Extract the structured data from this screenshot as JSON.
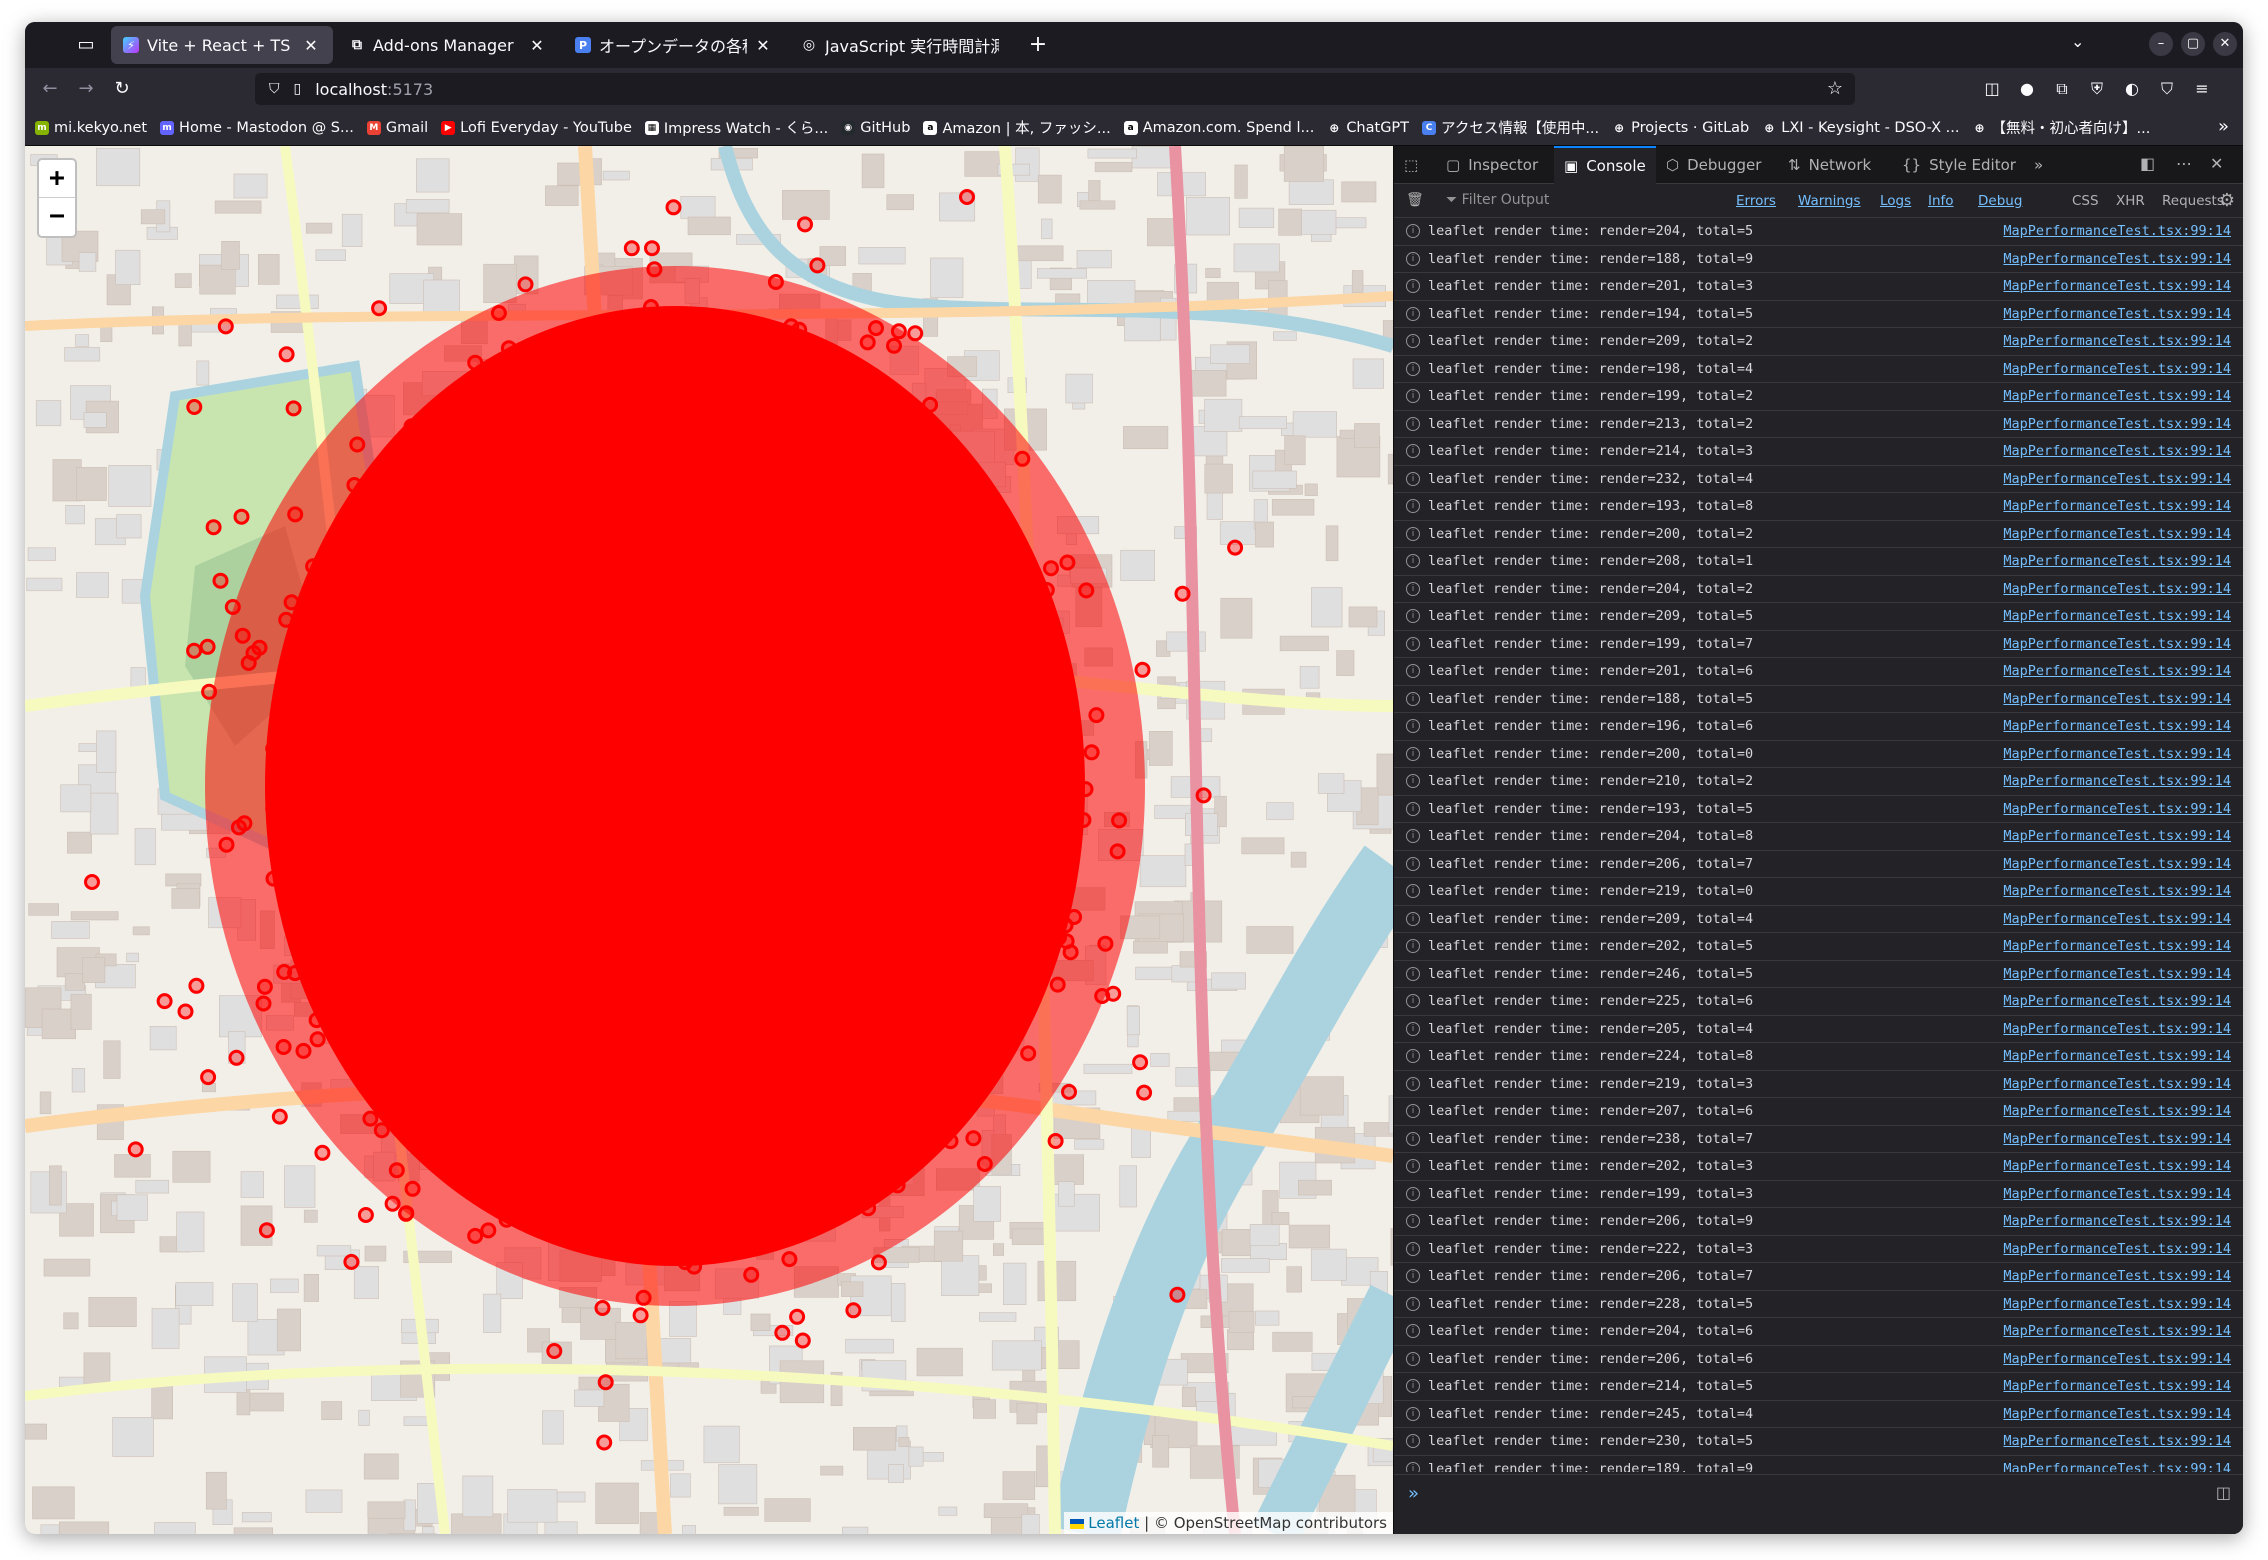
{
  "browser": {
    "tabs": [
      {
        "label": "Vite + React + TS",
        "active": true
      },
      {
        "label": "Add-ons Manager",
        "active": false
      },
      {
        "label": "オープンデータの各種マ",
        "active": false
      },
      {
        "label": "JavaScript 実行時間計測",
        "active": false
      }
    ],
    "new_tab": "+",
    "url_host": "localhost",
    "url_port": ":5173"
  },
  "bookmarks": [
    "mi.kekyo.net",
    "Home - Mastodon @ S...",
    "Gmail",
    "Lofi Everyday - YouTube",
    "Impress Watch - くら...",
    "GitHub",
    "Amazon | 本, ファッシ...",
    "Amazon.com. Spend l...",
    "ChatGPT",
    "アクセス情報【使用中...",
    "Projects · GitLab",
    "LXI - Keysight - DSO-X ...",
    "【無料・初心者向け】..."
  ],
  "map": {
    "zoom_in": "+",
    "zoom_out": "−",
    "attribution_leaflet": "Leaflet",
    "attribution_rest": " | © OpenStreetMap contributors",
    "marker_color": "#ff0000"
  },
  "devtools": {
    "tabs": [
      "Inspector",
      "Console",
      "Debugger",
      "Network",
      "Style Editor"
    ],
    "active_tab": "Console",
    "filter_placeholder": "Filter Output",
    "levels": [
      "Errors",
      "Warnings",
      "Logs",
      "Info",
      "Debug"
    ],
    "types": [
      "CSS",
      "XHR",
      "Requests"
    ],
    "log_prefix": "leaflet render time: ",
    "log_source": "MapPerformanceTest.tsx:99:14",
    "logs": [
      [
        204,
        5
      ],
      [
        188,
        9
      ],
      [
        201,
        3
      ],
      [
        194,
        5
      ],
      [
        209,
        2
      ],
      [
        198,
        4
      ],
      [
        199,
        2
      ],
      [
        213,
        2
      ],
      [
        214,
        3
      ],
      [
        232,
        4
      ],
      [
        193,
        8
      ],
      [
        200,
        2
      ],
      [
        208,
        1
      ],
      [
        204,
        2
      ],
      [
        209,
        5
      ],
      [
        199,
        7
      ],
      [
        201,
        6
      ],
      [
        188,
        5
      ],
      [
        196,
        6
      ],
      [
        200,
        0
      ],
      [
        210,
        2
      ],
      [
        193,
        5
      ],
      [
        204,
        8
      ],
      [
        206,
        7
      ],
      [
        219,
        0
      ],
      [
        209,
        4
      ],
      [
        202,
        5
      ],
      [
        246,
        5
      ],
      [
        225,
        6
      ],
      [
        205,
        4
      ],
      [
        224,
        8
      ],
      [
        219,
        3
      ],
      [
        207,
        6
      ],
      [
        238,
        7
      ],
      [
        202,
        3
      ],
      [
        199,
        3
      ],
      [
        206,
        9
      ],
      [
        222,
        3
      ],
      [
        206,
        7
      ],
      [
        228,
        5
      ],
      [
        204,
        6
      ],
      [
        206,
        6
      ],
      [
        214,
        5
      ],
      [
        245,
        4
      ],
      [
        230,
        5
      ],
      [
        189,
        9
      ]
    ]
  }
}
